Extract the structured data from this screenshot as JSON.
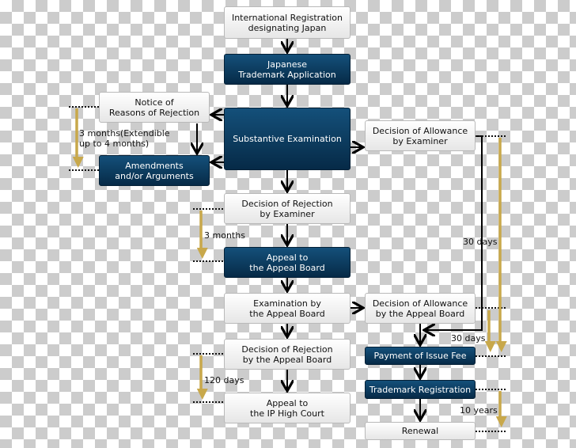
{
  "colors": {
    "dark_box": "#0b3a5e",
    "light_box": "#f2f2f2",
    "period_arrow": "#c8a84b",
    "flow_arrow": "#000000"
  },
  "boxes": {
    "intl_registration": "International Registration\ndesignating Japan",
    "japanese_application": "Japanese\nTrademark Application",
    "notice_rejection": "Notice of\nReasons of Rejection",
    "substantive_exam": "Substantive Examination",
    "amendments": "Amendments\nand/or Arguments",
    "allowance_examiner": "Decision of Allowance\nby Examiner",
    "rejection_examiner": "Decision of Rejection\nby Examiner",
    "appeal_board": "Appeal to\nthe Appeal Board",
    "exam_appeal_board": "Examination by\nthe Appeal Board",
    "allowance_appeal_board": "Decision of Allowance\nby the Appeal Board",
    "rejection_appeal_board": "Decision of Rejection\nby the Appeal Board",
    "ip_high_court": "Appeal to\nthe IP High Court",
    "issue_fee": "Payment of Issue Fee",
    "registration": "Trademark Registration",
    "renewal": "Renewal"
  },
  "periods": {
    "amendments": "3 months(Extendible\nup to 4 months)",
    "appeal": "3 months",
    "high_court": "120 days",
    "fee_examiner": "30 days",
    "fee_board": "30 days",
    "renewal": "10 years"
  }
}
